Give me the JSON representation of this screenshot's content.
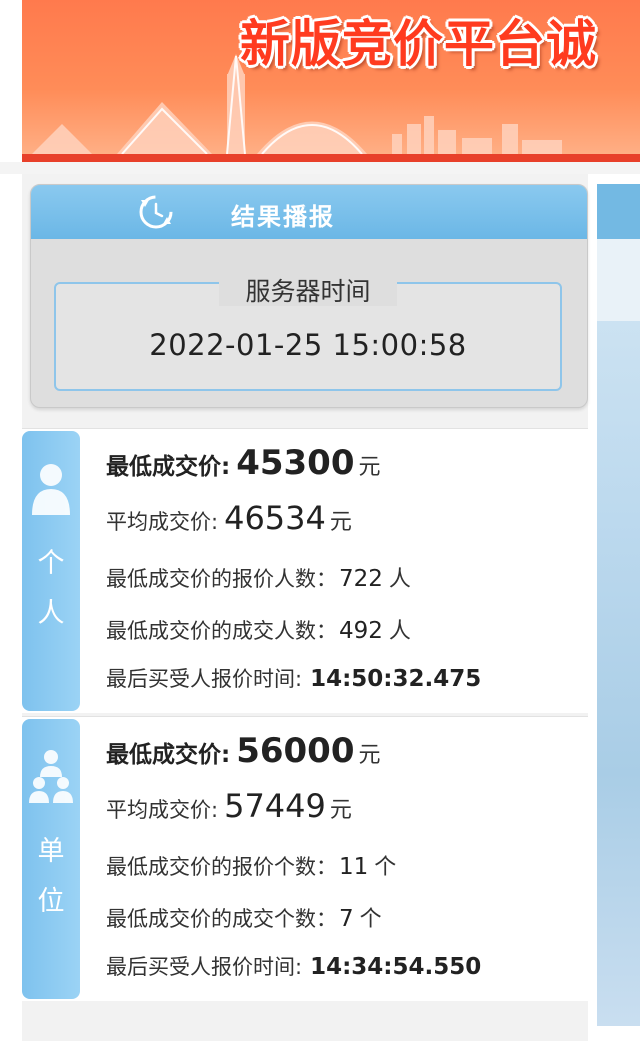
{
  "banner": {
    "title": "新版竞价平台诚"
  },
  "broadcast": {
    "header_title": "结果播报",
    "server_time_label": "服务器时间",
    "server_time_value": "2022-01-25 15:00:58"
  },
  "personal": {
    "tab_label_1": "个",
    "tab_label_2": "人",
    "lowest_price_label": "最低成交价:",
    "lowest_price_value": "45300",
    "avg_price_label": "平均成交价:",
    "avg_price_value": "46534",
    "currency_unit": "元",
    "lowest_bid_count_label": "最低成交价的报价人数：",
    "lowest_bid_count_value": "722",
    "lowest_deal_count_label": "最低成交价的成交人数：",
    "lowest_deal_count_value": "492",
    "count_unit": "人",
    "last_bid_time_label": "最后买受人报价时间:",
    "last_bid_time_value": "14:50:32.475"
  },
  "company": {
    "tab_label_1": "单",
    "tab_label_2": "位",
    "lowest_price_label": "最低成交价:",
    "lowest_price_value": "56000",
    "avg_price_label": "平均成交价:",
    "avg_price_value": "57449",
    "currency_unit": "元",
    "lowest_bid_count_label": "最低成交价的报价个数：",
    "lowest_bid_count_value": "11",
    "lowest_deal_count_label": "最低成交价的成交个数：",
    "lowest_deal_count_value": "7",
    "count_unit": "个",
    "last_bid_time_label": "最后买受人报价时间:",
    "last_bid_time_value": "14:34:54.550"
  },
  "colors": {
    "banner_orange": "#ff7a4d",
    "banner_red_stripe": "#e8402a",
    "panel_blue": "#6bb7e6",
    "tab_blue": "#7ec2ee"
  },
  "icons": [
    "refresh-icon",
    "person-icon",
    "group-icon"
  ]
}
